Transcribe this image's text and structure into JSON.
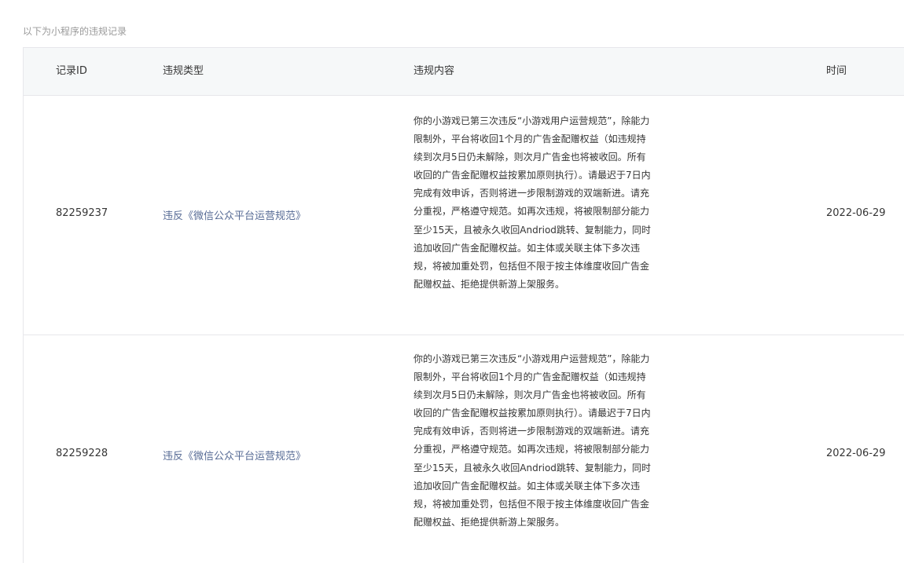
{
  "caption": "以下为小程序的违规记录",
  "table": {
    "headers": {
      "id": "记录ID",
      "type": "违规类型",
      "content": "违规内容",
      "time": "时间"
    },
    "rows": [
      {
        "id": "82259237",
        "type": "违反《微信公众平台运营规范》",
        "content": "你的小游戏已第三次违反“小游戏用户运营规范”，除能力限制外，平台将收回1个月的广告金配赠权益（如违规持续到次月5日仍未解除，则次月广告金也将被收回。所有收回的广告金配赠权益按累加原则执行）。请最迟于7日内完成有效申诉，否则将进一步限制游戏的双端新进。请充分重视，严格遵守规范。如再次违规，将被限制部分能力至少15天，且被永久收回Andriod跳转、复制能力，同时追加收回广告金配赠权益。如主体或关联主体下多次违规，将被加重处罚，包括但不限于按主体维度收回广告金配赠权益、拒绝提供新游上架服务。",
        "time": "2022-06-29"
      },
      {
        "id": "82259228",
        "type": "违反《微信公众平台运营规范》",
        "content": "你的小游戏已第三次违反“小游戏用户运营规范”，除能力限制外，平台将收回1个月的广告金配赠权益（如违规持续到次月5日仍未解除，则次月广告金也将被收回。所有收回的广告金配赠权益按累加原则执行）。请最迟于7日内完成有效申诉，否则将进一步限制游戏的双端新进。请充分重视，严格遵守规范。如再次违规，将被限制部分能力至少15天，且被永久收回Andriod跳转、复制能力，同时追加收回广告金配赠权益。如主体或关联主体下多次违规，将被加重处罚，包括但不限于按主体维度收回广告金配赠权益、拒绝提供新游上架服务。",
        "time": "2022-06-29"
      }
    ]
  },
  "colors": {
    "link": "#576b95",
    "header_bg": "#f6f8f9",
    "border": "#e7e7eb",
    "caption": "#9a9a9a"
  }
}
